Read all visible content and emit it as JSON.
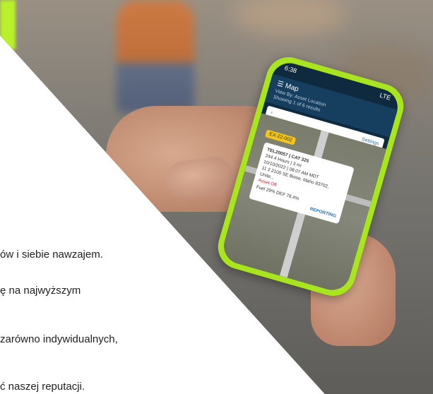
{
  "photo": {
    "phone": {
      "time": "6:38",
      "signal": "LTE",
      "app_title": "Map",
      "view_by": "View By: Asset Location",
      "showing": "Showing 1 of 6 results",
      "settings": "Settings",
      "marker": "EX-22-002",
      "popup": {
        "title": "TEL20057 | CAT 325",
        "hours": "244.4 Hours | 3 mi",
        "date": "10/10/2022 | 08:07 AM MDT",
        "address": "11 2 2100 SE Boise, Idaho 83702, Unite...",
        "status": "Asset Off",
        "fuel": "Fuel 29% DEF 78.4%",
        "reporting": "REPORTING"
      },
      "accent_color": "#a8e51f"
    }
  },
  "text_lines": [
    "ów i siebie nawzajem.",
    "ę na najwyższym",
    "zarówno indywidualnych,",
    "ć naszej reputacji."
  ]
}
